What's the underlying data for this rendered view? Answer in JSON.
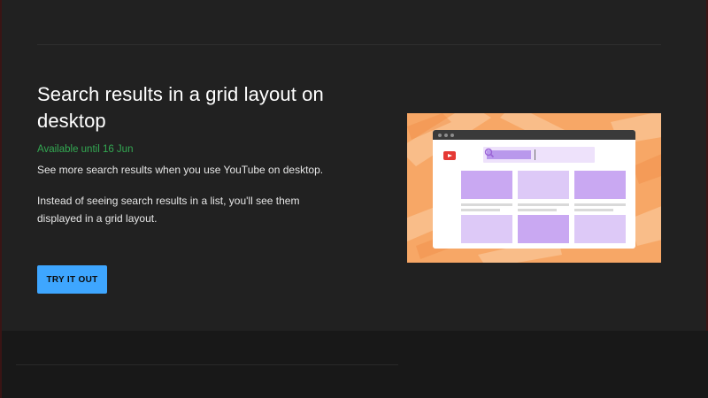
{
  "feature": {
    "title": "Search results in a grid layout on desktop",
    "availability": "Available until 16 Jun",
    "description_1": "See more search results when you use YouTube on desktop.",
    "description_2": "Instead of seeing search results in a list, you'll see them displayed in a grid layout.",
    "try_button_label": "TRY IT OUT"
  },
  "colors": {
    "accent_button": "#3ea6ff",
    "availability_green": "#33a852",
    "illustration_bg": "#f7a766",
    "youtube_red": "#e53935",
    "thumbnail_dark": "#c9a8f2",
    "thumbnail_light": "#ddc9f7"
  },
  "illustration": {
    "icons": [
      "youtube-logo-icon",
      "search-icon"
    ],
    "thumbnail_rows": 2,
    "thumbnail_columns": 3
  }
}
